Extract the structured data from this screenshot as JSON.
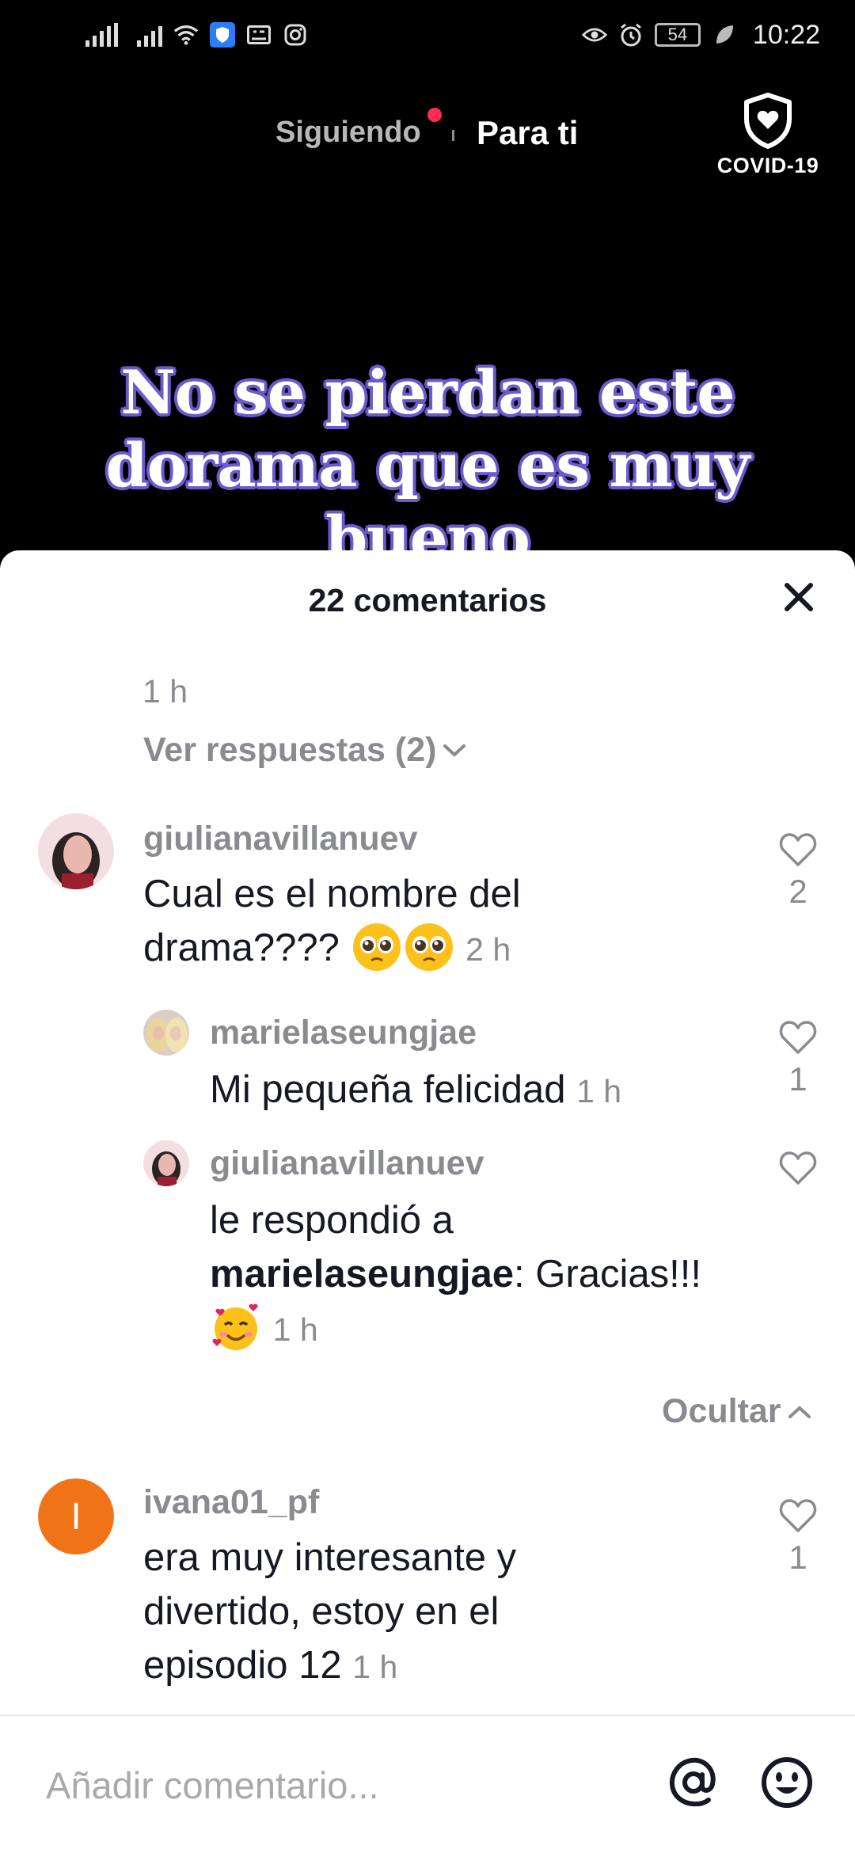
{
  "status_bar": {
    "time": "10:22",
    "battery": "54"
  },
  "top_nav": {
    "following_label": "Siguiendo",
    "for_you_label": "Para ti",
    "covid_label": "COVID-19"
  },
  "video": {
    "caption": "No se pierdan este dorama que es muy bueno"
  },
  "comments_sheet": {
    "title": "22 comentarios",
    "prev_timestamp": "1 h",
    "view_replies": "Ver respuestas (2)",
    "comments": [
      {
        "username": "giulianavillanuev",
        "text": "Cual es el nombre del drama???? ",
        "emojis": [
          "pleading-face-emoji",
          "pleading-face-emoji"
        ],
        "time": "2 h",
        "likes": "2",
        "replies": [
          {
            "username": "marielaseungjae",
            "text": "Mi pequeña felicidad",
            "time": "1 h",
            "likes": "1"
          },
          {
            "username": "giulianavillanuev",
            "prefix": "le respondió a",
            "mention": "marielaseungjae",
            "text": ": Gracias!!!",
            "emoji": "smiling-face-with-hearts-emoji",
            "time": "1 h",
            "likes": ""
          }
        ]
      },
      {
        "username": "ivana01_pf",
        "avatar_letter": "I",
        "avatar_color": "#f07318",
        "text": "era muy interesante y divertido, estoy en el episodio 12",
        "time": "1 h",
        "likes": "1"
      }
    ],
    "hide_label": "Ocultar",
    "input_placeholder": "Añadir comentario..."
  },
  "colors": {
    "accent": "#fe2c55",
    "muted": "#8a8b91",
    "text": "#161823"
  }
}
